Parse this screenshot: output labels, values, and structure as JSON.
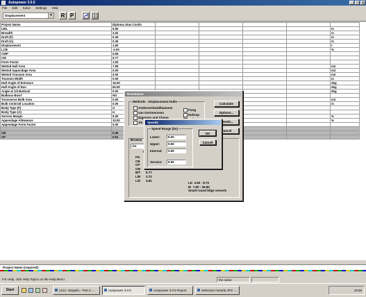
{
  "app": {
    "title": "Autopower 3.0.5",
    "min": "_",
    "max": "□",
    "close": "x"
  },
  "menu": [
    "File",
    "Edit",
    "Solve",
    "Settings",
    "Help"
  ],
  "toolbar": {
    "combo_value": "Displacement",
    "btn_r": "R",
    "btn_p": "P"
  },
  "grid": {
    "rows": [
      {
        "label": "Project Name",
        "value": "Diploma Stan Costin",
        "unit": ""
      },
      {
        "label": "LWL",
        "value": "5.50",
        "unit": "m"
      },
      {
        "label": "Breadth",
        "value": "2.02",
        "unit": "m"
      },
      {
        "label": "Draft (F)",
        "value": "0.35",
        "unit": "m"
      },
      {
        "label": "Draft (A)",
        "value": "0.35",
        "unit": "m"
      },
      {
        "label": "Displacement",
        "value": "1.60",
        "unit": "t"
      },
      {
        "label": "LCB",
        "value": "-2.00",
        "unit": "%"
      },
      {
        "label": "CWP",
        "value": "0.65",
        "unit": ""
      },
      {
        "label": "CM",
        "value": "0.77",
        "unit": ""
      },
      {
        "label": "Form Factor",
        "value": "1.00",
        "unit": ""
      },
      {
        "label": "Wetted Hull Area",
        "value": "7.95",
        "unit": "m2"
      },
      {
        "label": "Wetted Appendage Area",
        "value": "0.00",
        "unit": "m2"
      },
      {
        "label": "Wetted Transom Area",
        "value": "0.00",
        "unit": "m2"
      },
      {
        "label": "Transom Width",
        "value": "0.00",
        "unit": "m"
      },
      {
        "label": "Half Angle of Entrance",
        "value": "15.00",
        "unit": "deg"
      },
      {
        "label": "Half Angle of Run",
        "value": "60.00",
        "unit": "deg"
      },
      {
        "label": "Angle at 1/4 Buttock",
        "value": "0.00",
        "unit": "deg"
      },
      {
        "label": "Bulbous Bow?",
        "value": "NO",
        "unit": ""
      },
      {
        "label": "Transverse Bulb Area",
        "value": "0.00",
        "unit": "m2"
      },
      {
        "label": "Bulb Centroid Location",
        "value": "0.00",
        "unit": "m"
      },
      {
        "label": "Body Type (F)",
        "value": "U",
        "unit": ""
      },
      {
        "label": "Body Type (A)",
        "value": "U",
        "unit": ""
      },
      {
        "label": "Service Margin",
        "value": "5.00",
        "unit": "%"
      },
      {
        "label": "Appendage Allowance",
        "value": "10.00",
        "unit": "%"
      },
      {
        "label": "Appendage Form Factor",
        "value": "0.00",
        "unit": ""
      },
      {
        "label": "",
        "value": "",
        "unit": "",
        "gray": true
      },
      {
        "label": "CB",
        "value": "0.40",
        "unit": "",
        "gray": true
      },
      {
        "label": "CP",
        "value": "0.51",
        "unit": "",
        "gray": true
      }
    ]
  },
  "status_field": "Project Name (required)",
  "hint": "For Help, click Help Topics on the Help Menu.",
  "hint_panel": "the name",
  "resistance_dialog": {
    "title": "Resistance",
    "group_title": "Methods - Displacement Hulls",
    "methods_left": [
      "Andersen/Guldhammer",
      "van Oortmerssen",
      "Digernes and Cheng",
      "Jin"
    ],
    "methods_right": [
      "Fung",
      "Holtrop",
      "Calisal"
    ],
    "calculate": "Calculate",
    "options": "Options...",
    "speeds": "Speeds...",
    "cancel": "Cancel",
    "browse_label": "Browse",
    "browse_value": "Jin",
    "project_label": "Project",
    "coeff_names": "FN\nCB\nCP\nCM\nB/T\nL/B\nL/D",
    "coeff_values": "\n\n\n\n5.77\n2.72\n4.81",
    "range_text": "LD  4.50 - 8.70\nIE  7.60 - 26.60\nSmall round bilge vessels"
  },
  "speeds_dialog": {
    "title": "Speeds",
    "group_title": "Speed Range (kn)",
    "lower_label": "Lower:",
    "lower": "6.00",
    "upper_label": "Upper:",
    "upper": "9.50",
    "interval_label": "Interval:",
    "interval": "0.50",
    "service_label": "Service:",
    "service": "6.50",
    "ok": "OK",
    "cancel": "Cancel"
  },
  "taskbar": {
    "start": "Start",
    "tasks": [
      "1212. Vangelis - Part 2 -...",
      "Autopower 3.0.5",
      "Autopower 3.0.5 Report",
      "Selectare metoda.JPG -..."
    ],
    "clock": "16:58"
  }
}
